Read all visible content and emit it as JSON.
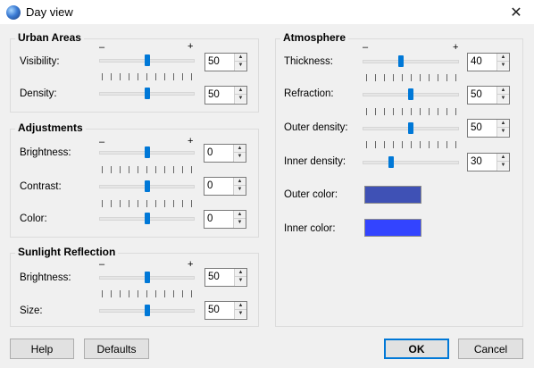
{
  "window": {
    "title": "Day view",
    "close_glyph": "✕"
  },
  "urban": {
    "title": "Urban Areas",
    "minus": "–",
    "plus": "+",
    "visibility": {
      "label": "Visibility:",
      "value": "50",
      "level": 0.5
    },
    "density": {
      "label": "Density:",
      "value": "50",
      "level": 0.5
    }
  },
  "adjustments": {
    "title": "Adjustments",
    "minus": "–",
    "plus": "+",
    "brightness": {
      "label": "Brightness:",
      "value": "0",
      "level": 0.5
    },
    "contrast": {
      "label": "Contrast:",
      "value": "0",
      "level": 0.5
    },
    "color": {
      "label": "Color:",
      "value": "0",
      "level": 0.5
    }
  },
  "sunlight": {
    "title": "Sunlight Reflection",
    "minus": "–",
    "plus": "+",
    "brightness": {
      "label": "Brightness:",
      "value": "50",
      "level": 0.5
    },
    "size": {
      "label": "Size:",
      "value": "50",
      "level": 0.5
    }
  },
  "atmosphere": {
    "title": "Atmosphere",
    "minus": "–",
    "plus": "+",
    "thickness": {
      "label": "Thickness:",
      "value": "40",
      "level": 0.4
    },
    "refraction": {
      "label": "Refraction:",
      "value": "50",
      "level": 0.5
    },
    "outer_density": {
      "label": "Outer density:",
      "value": "50",
      "level": 0.5
    },
    "inner_density": {
      "label": "Inner density:",
      "value": "30",
      "level": 0.3
    },
    "outer_color": {
      "label": "Outer color:",
      "color": "#3f51b5"
    },
    "inner_color": {
      "label": "Inner color:",
      "color": "#3344ff"
    }
  },
  "buttons": {
    "help": "Help",
    "defaults": "Defaults",
    "ok": "OK",
    "cancel": "Cancel"
  },
  "icons": {
    "app": "globe-icon",
    "close": "close-icon",
    "spin_up": "spin-up-arrow-icon",
    "spin_down": "spin-down-arrow-icon"
  }
}
